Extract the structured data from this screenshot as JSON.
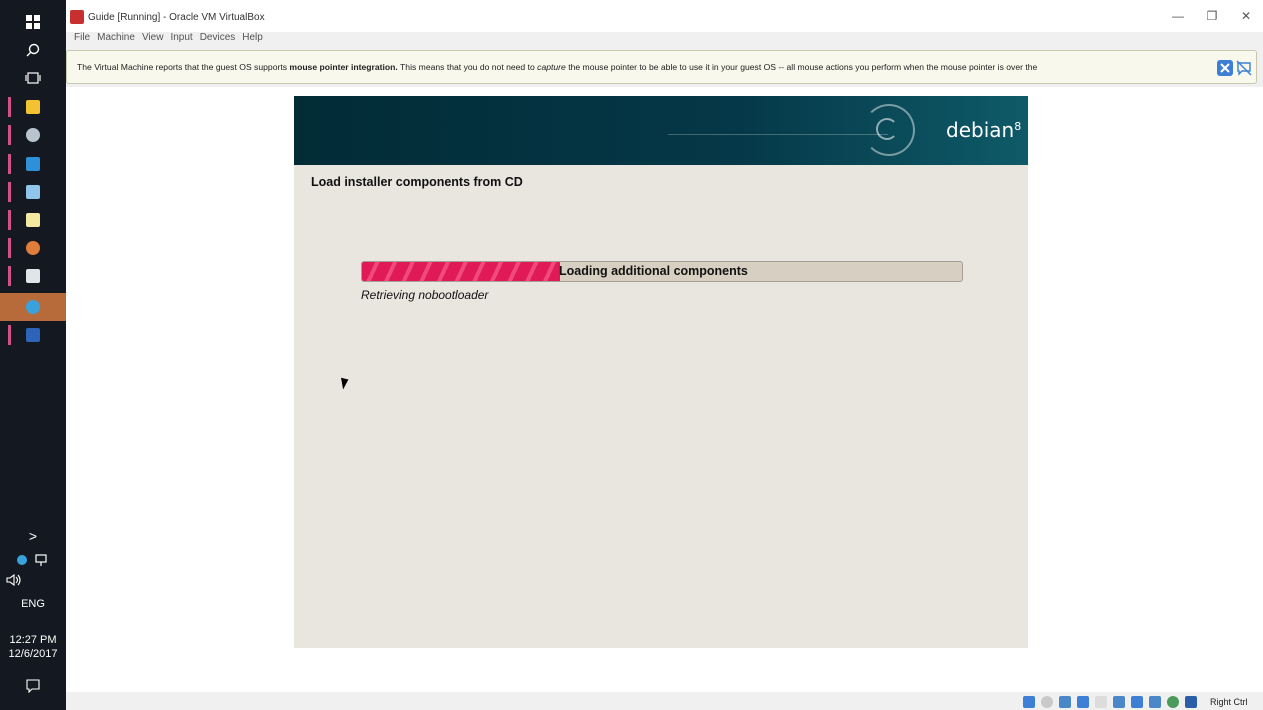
{
  "window": {
    "title": "Guide [Running] - Oracle VM VirtualBox",
    "minimize": "—",
    "restore": "❐",
    "close": "✕"
  },
  "menu": [
    "File",
    "Machine",
    "View",
    "Input",
    "Devices",
    "Help"
  ],
  "notice": {
    "text_pre": "The Virtual Machine reports that the guest OS supports ",
    "text_bold": "mouse pointer integration.",
    "text_mid": " This means that you do not need to ",
    "text_italic": "capture",
    "text_post": " the mouse pointer to be able to use it in your guest OS -- all mouse actions you perform when the mouse pointer is over the"
  },
  "guest": {
    "logo": "debian",
    "logo_version": "8",
    "step_title": "Load installer components from CD",
    "progress_label": "Loading additional components",
    "progress_fraction": 0.33,
    "progress_sub": "Retrieving nobootloader"
  },
  "taskbar": {
    "tray_arrow": ">",
    "language": "ENG",
    "time": "12:27 PM",
    "date": "12/6/2017"
  },
  "statusbar": {
    "host_key": "Right Ctrl"
  },
  "colors": {
    "progress_fill": "#e01a56",
    "debian_header": "#053848",
    "guest_background": "#e8e6df",
    "taskbar": "#141820"
  }
}
